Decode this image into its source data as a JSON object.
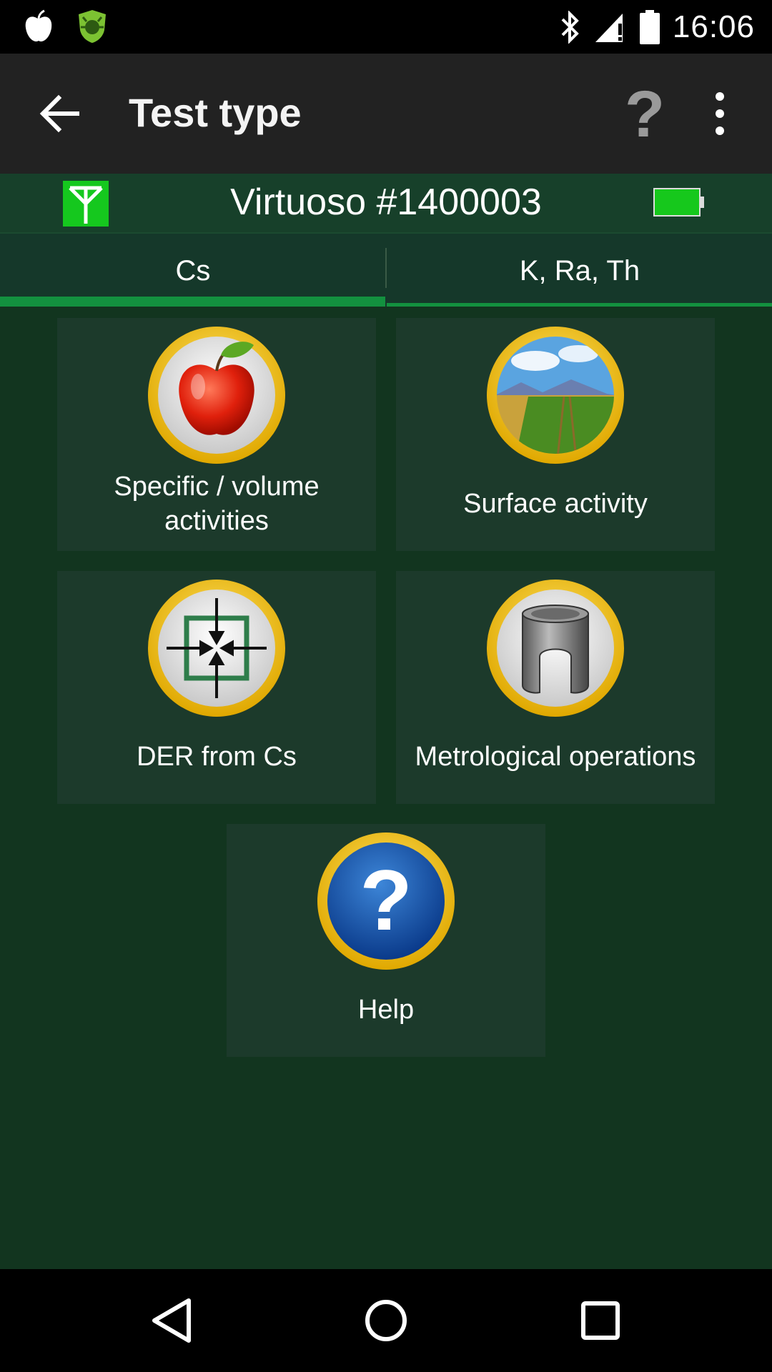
{
  "status_bar": {
    "time": "16:06",
    "icons": [
      "apple-notification-icon",
      "shield-bug-notification-icon",
      "bluetooth-icon",
      "signal-warning-icon",
      "battery-full-icon"
    ]
  },
  "app_bar": {
    "title": "Test type",
    "icons": [
      "back-arrow-icon",
      "help-question-icon",
      "overflow-menu-icon"
    ]
  },
  "device": {
    "name": "Virtuoso #1400003",
    "icons": [
      "antenna-signal-icon",
      "device-battery-icon"
    ],
    "colors": {
      "antenna_bg": "#15c81e",
      "battery_fill": "#16c81c"
    }
  },
  "tabs": [
    {
      "label": "Cs",
      "selected": true
    },
    {
      "label": "K, Ra, Th",
      "selected": false
    }
  ],
  "tiles": [
    {
      "label_line1": "Specific / volume",
      "label_line2": "activities",
      "icon": "apple-icon"
    },
    {
      "label_line1": "Surface activity",
      "icon": "landscape-field-icon"
    },
    {
      "label_line1": "DER from Cs",
      "icon": "arrows-to-center-icon"
    },
    {
      "label_line1": "Metrological operations",
      "icon": "lead-shield-icon"
    },
    {
      "label_line1": "Help",
      "icon": "help-circle-icon"
    }
  ],
  "nav_bar": {
    "icons": [
      "back-triangle-icon",
      "home-circle-icon",
      "recents-square-icon"
    ]
  },
  "colors": {
    "background": "#12351f",
    "tab_indicator": "#13913f",
    "tile_bg": "#1c3a2b",
    "icon_ring": "#f2c200"
  }
}
